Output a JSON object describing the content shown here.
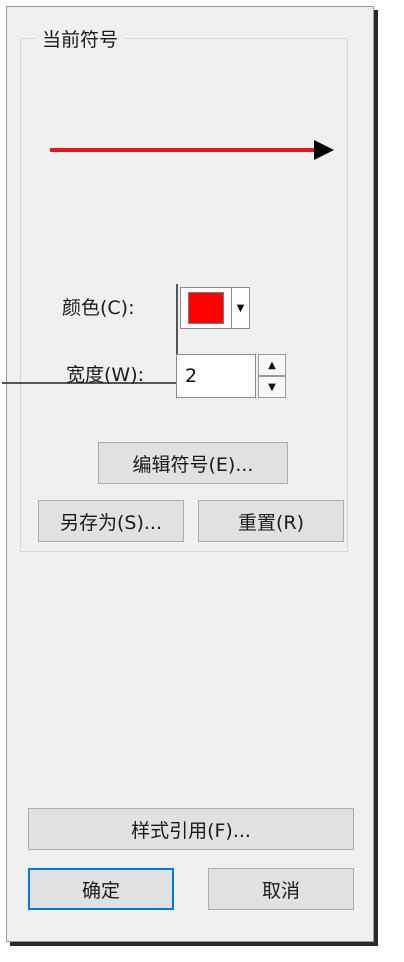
{
  "group": {
    "title": "当前符号"
  },
  "preview": {
    "line_color": "#e8161b",
    "arrow_color": "#000000"
  },
  "color": {
    "label": "颜色(C):",
    "value": "#ff0000",
    "dropdown_icon": "triangle-down"
  },
  "width": {
    "label": "宽度(W):",
    "value": "2",
    "up_icon": "triangle-up",
    "down_icon": "triangle-down"
  },
  "buttons": {
    "edit_symbol": "编辑符号(E)...",
    "save_as": "另存为(S)...",
    "reset": "重置(R)",
    "style_reference": "样式引用(F)...",
    "ok": "确定",
    "cancel": "取消"
  }
}
